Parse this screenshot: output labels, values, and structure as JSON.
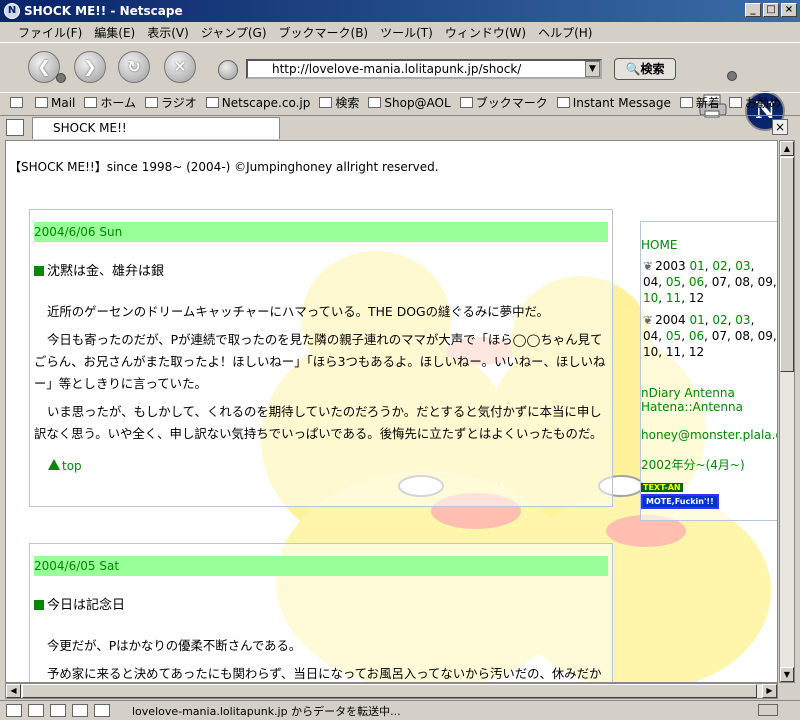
{
  "window": {
    "title": "SHOCK ME!! - Netscape",
    "app_icon": "netscape-icon"
  },
  "menubar": [
    "ファイル(F)",
    "編集(E)",
    "表示(V)",
    "ジャンプ(G)",
    "ブックマーク(B)",
    "ツール(T)",
    "ウィンドウ(W)",
    "ヘルプ(H)"
  ],
  "navigation": {
    "url": "http://lovelove-mania.lolitapunk.jp/shock/",
    "search_label": "検索"
  },
  "personal_toolbar": [
    "Mail",
    "ホーム",
    "ラジオ",
    "Netscape.co.jp",
    "検索",
    "Shop@AOL",
    "ブックマーク",
    "Instant Message",
    "新着",
    "お勧め"
  ],
  "tab": {
    "title": "SHOCK ME!!"
  },
  "page": {
    "copyright": "【SHOCK ME!!】since 1998~ (2004-) ©Jumpinghoney allright reserved.",
    "entries": [
      {
        "date": "2004/6/06 Sun",
        "heading": "沈黙は金、雄弁は銀",
        "paragraphs": [
          "近所のゲーセンのドリームキャッチャーにハマっている。THE DOGの縫ぐるみに夢中だ。",
          "今日も寄ったのだが、Pが連続で取ったのを見た隣の親子連れのママが大声で「ほら◯◯ちゃん見てごらん、お兄さんがまた取ったよ！ほしいねー」「ほら3つもあるよ。ほしいねー。いいねー、ほしいねー」等としきりに言っていた。",
          "いま思ったが、もしかして、くれるのを期待していたのだろうか。だとすると気付かずに本当に申し訳なく思う。いや全く、申し訳ない気持ちでいっぱいである。後悔先に立たずとはよくいったものだ。"
        ],
        "top_link": "top"
      },
      {
        "date": "2004/6/05 Sat",
        "heading": "今日は記念日",
        "paragraphs": [
          "今更だが、Pはかなりの優柔不断さんである。",
          "予め家に来ると決めてあったにも関わらず、当日になってお風呂入ってないから汚いだの、休みだからまだ"
        ]
      }
    ],
    "sidebar": {
      "home": "HOME",
      "years": [
        {
          "year": "2003",
          "months_linked": [
            "01",
            "02",
            "03"
          ],
          "months_row2_linked": [
            "05",
            "06"
          ],
          "months_row2_plain": [
            "04",
            "07",
            "08",
            "09"
          ],
          "months_row3_linked": [
            "10",
            "11"
          ],
          "months_row3_plain": [
            "12"
          ]
        },
        {
          "year": "2004",
          "months_linked": [
            "01",
            "02",
            "03"
          ],
          "months_row2_linked": [
            "05",
            "06"
          ],
          "months_row2_plain": [
            "04",
            "07",
            "08",
            "09"
          ],
          "months_row3_linked": [],
          "months_row3_plain": [
            "10",
            "11",
            "12"
          ]
        }
      ],
      "links": [
        "nDiary Antenna",
        "Hatena::Antenna"
      ],
      "email": "honey@monster.plala.or.jp",
      "note": "2002年分~(4月~)",
      "badges": [
        "TEXT-AN",
        "MOTE,Fuckin'!!"
      ]
    }
  },
  "status": {
    "text": "lovelove-mania.lolitapunk.jp からデータを転送中..."
  }
}
